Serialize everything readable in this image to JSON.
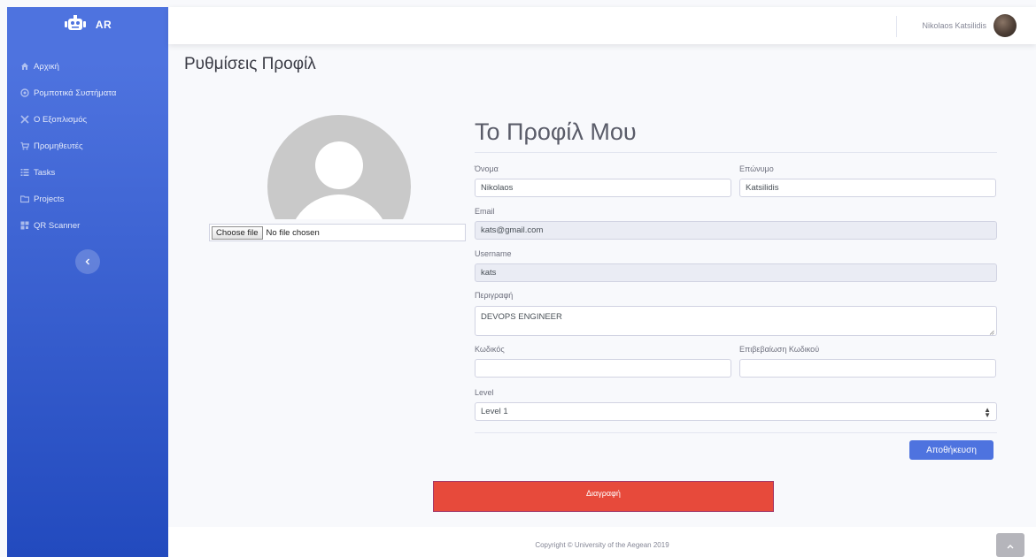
{
  "brand": {
    "name": "AR"
  },
  "sidebar": {
    "items": [
      {
        "label": "Αρχική",
        "icon": "home-icon"
      },
      {
        "label": "Ρομποτικά Συστήματα",
        "icon": "robot-icon"
      },
      {
        "label": "Ο Εξοπλισμός",
        "icon": "tools-icon"
      },
      {
        "label": "Προμηθευτές",
        "icon": "cart-icon"
      },
      {
        "label": "Tasks",
        "icon": "list-icon"
      },
      {
        "label": "Projects",
        "icon": "folder-icon"
      },
      {
        "label": "QR Scanner",
        "icon": "qrcode-icon"
      }
    ],
    "toggle_icon": "chevron-left-icon"
  },
  "topbar": {
    "user_name": "Nikolaos Katsilidis"
  },
  "page": {
    "title": "Ρυθμίσεις Προφίλ"
  },
  "upload": {
    "button_label": "Choose file",
    "status": "No file chosen"
  },
  "profile": {
    "heading": "Το Προφίλ Μου",
    "first_name_label": "Όνομα",
    "first_name": "Nikolaos",
    "last_name_label": "Επώνυμο",
    "last_name": "Katsilidis",
    "email_label": "Email",
    "email": "kats@gmail.com",
    "username_label": "Username",
    "username": "kats",
    "description_label": "Περιγραφή",
    "description": "DEVOPS ENGINEER",
    "password_label": "Κωδικός",
    "password_confirm_label": "Επιβεβαίωση Κωδικού",
    "level_label": "Level",
    "level_value": "Level 1",
    "save_label": "Αποθήκευση",
    "delete_label": "Διαγραφή"
  },
  "footer": {
    "copyright": "Copyright © University of the Aegean 2019"
  },
  "colors": {
    "primary": "#4e73df",
    "danger": "#e74a3b",
    "sidebar_end": "#224abe"
  }
}
